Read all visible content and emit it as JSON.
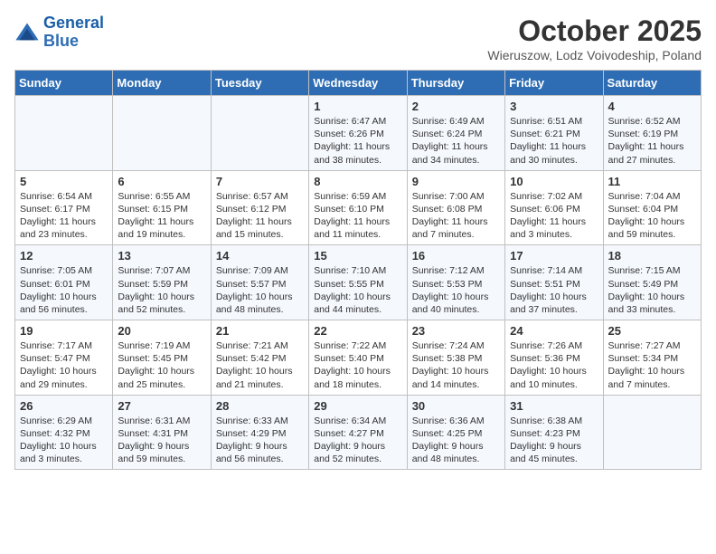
{
  "header": {
    "logo_line1": "General",
    "logo_line2": "Blue",
    "month": "October 2025",
    "location": "Wieruszow, Lodz Voivodeship, Poland"
  },
  "days_of_week": [
    "Sunday",
    "Monday",
    "Tuesday",
    "Wednesday",
    "Thursday",
    "Friday",
    "Saturday"
  ],
  "weeks": [
    [
      {
        "day": "",
        "data": ""
      },
      {
        "day": "",
        "data": ""
      },
      {
        "day": "",
        "data": ""
      },
      {
        "day": "1",
        "data": "Sunrise: 6:47 AM\nSunset: 6:26 PM\nDaylight: 11 hours\nand 38 minutes."
      },
      {
        "day": "2",
        "data": "Sunrise: 6:49 AM\nSunset: 6:24 PM\nDaylight: 11 hours\nand 34 minutes."
      },
      {
        "day": "3",
        "data": "Sunrise: 6:51 AM\nSunset: 6:21 PM\nDaylight: 11 hours\nand 30 minutes."
      },
      {
        "day": "4",
        "data": "Sunrise: 6:52 AM\nSunset: 6:19 PM\nDaylight: 11 hours\nand 27 minutes."
      }
    ],
    [
      {
        "day": "5",
        "data": "Sunrise: 6:54 AM\nSunset: 6:17 PM\nDaylight: 11 hours\nand 23 minutes."
      },
      {
        "day": "6",
        "data": "Sunrise: 6:55 AM\nSunset: 6:15 PM\nDaylight: 11 hours\nand 19 minutes."
      },
      {
        "day": "7",
        "data": "Sunrise: 6:57 AM\nSunset: 6:12 PM\nDaylight: 11 hours\nand 15 minutes."
      },
      {
        "day": "8",
        "data": "Sunrise: 6:59 AM\nSunset: 6:10 PM\nDaylight: 11 hours\nand 11 minutes."
      },
      {
        "day": "9",
        "data": "Sunrise: 7:00 AM\nSunset: 6:08 PM\nDaylight: 11 hours\nand 7 minutes."
      },
      {
        "day": "10",
        "data": "Sunrise: 7:02 AM\nSunset: 6:06 PM\nDaylight: 11 hours\nand 3 minutes."
      },
      {
        "day": "11",
        "data": "Sunrise: 7:04 AM\nSunset: 6:04 PM\nDaylight: 10 hours\nand 59 minutes."
      }
    ],
    [
      {
        "day": "12",
        "data": "Sunrise: 7:05 AM\nSunset: 6:01 PM\nDaylight: 10 hours\nand 56 minutes."
      },
      {
        "day": "13",
        "data": "Sunrise: 7:07 AM\nSunset: 5:59 PM\nDaylight: 10 hours\nand 52 minutes."
      },
      {
        "day": "14",
        "data": "Sunrise: 7:09 AM\nSunset: 5:57 PM\nDaylight: 10 hours\nand 48 minutes."
      },
      {
        "day": "15",
        "data": "Sunrise: 7:10 AM\nSunset: 5:55 PM\nDaylight: 10 hours\nand 44 minutes."
      },
      {
        "day": "16",
        "data": "Sunrise: 7:12 AM\nSunset: 5:53 PM\nDaylight: 10 hours\nand 40 minutes."
      },
      {
        "day": "17",
        "data": "Sunrise: 7:14 AM\nSunset: 5:51 PM\nDaylight: 10 hours\nand 37 minutes."
      },
      {
        "day": "18",
        "data": "Sunrise: 7:15 AM\nSunset: 5:49 PM\nDaylight: 10 hours\nand 33 minutes."
      }
    ],
    [
      {
        "day": "19",
        "data": "Sunrise: 7:17 AM\nSunset: 5:47 PM\nDaylight: 10 hours\nand 29 minutes."
      },
      {
        "day": "20",
        "data": "Sunrise: 7:19 AM\nSunset: 5:45 PM\nDaylight: 10 hours\nand 25 minutes."
      },
      {
        "day": "21",
        "data": "Sunrise: 7:21 AM\nSunset: 5:42 PM\nDaylight: 10 hours\nand 21 minutes."
      },
      {
        "day": "22",
        "data": "Sunrise: 7:22 AM\nSunset: 5:40 PM\nDaylight: 10 hours\nand 18 minutes."
      },
      {
        "day": "23",
        "data": "Sunrise: 7:24 AM\nSunset: 5:38 PM\nDaylight: 10 hours\nand 14 minutes."
      },
      {
        "day": "24",
        "data": "Sunrise: 7:26 AM\nSunset: 5:36 PM\nDaylight: 10 hours\nand 10 minutes."
      },
      {
        "day": "25",
        "data": "Sunrise: 7:27 AM\nSunset: 5:34 PM\nDaylight: 10 hours\nand 7 minutes."
      }
    ],
    [
      {
        "day": "26",
        "data": "Sunrise: 6:29 AM\nSunset: 4:32 PM\nDaylight: 10 hours\nand 3 minutes."
      },
      {
        "day": "27",
        "data": "Sunrise: 6:31 AM\nSunset: 4:31 PM\nDaylight: 9 hours\nand 59 minutes."
      },
      {
        "day": "28",
        "data": "Sunrise: 6:33 AM\nSunset: 4:29 PM\nDaylight: 9 hours\nand 56 minutes."
      },
      {
        "day": "29",
        "data": "Sunrise: 6:34 AM\nSunset: 4:27 PM\nDaylight: 9 hours\nand 52 minutes."
      },
      {
        "day": "30",
        "data": "Sunrise: 6:36 AM\nSunset: 4:25 PM\nDaylight: 9 hours\nand 48 minutes."
      },
      {
        "day": "31",
        "data": "Sunrise: 6:38 AM\nSunset: 4:23 PM\nDaylight: 9 hours\nand 45 minutes."
      },
      {
        "day": "",
        "data": ""
      }
    ]
  ]
}
